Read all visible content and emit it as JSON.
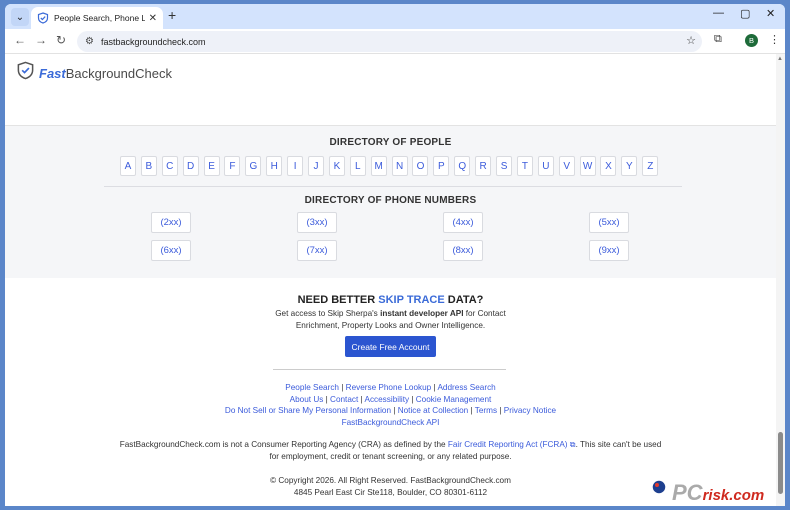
{
  "browser": {
    "tab_title": "People Search, Phone Lookup, A",
    "url": "fastbackgroundcheck.com",
    "profile_initial": "B"
  },
  "site": {
    "logo_fast": "Fast",
    "logo_rest": "BackgroundCheck"
  },
  "directory_people": {
    "title": "DIRECTORY OF PEOPLE",
    "letters": [
      "A",
      "B",
      "C",
      "D",
      "E",
      "F",
      "G",
      "H",
      "I",
      "J",
      "K",
      "L",
      "M",
      "N",
      "O",
      "P",
      "Q",
      "R",
      "S",
      "T",
      "U",
      "V",
      "W",
      "X",
      "Y",
      "Z"
    ]
  },
  "directory_phones": {
    "title": "DIRECTORY OF PHONE NUMBERS",
    "numbers": [
      "(2xx)",
      "(3xx)",
      "(4xx)",
      "(5xx)",
      "(6xx)",
      "(7xx)",
      "(8xx)",
      "(9xx)"
    ]
  },
  "cta": {
    "title_a": "NEED BETTER ",
    "title_b": "SKIP TRACE",
    "title_c": " DATA?",
    "desc_a": "Get access to Skip Sherpa's ",
    "desc_b": "instant developer API",
    "desc_c": " for Contact Enrichment, Property Looks and Owner Intelligence.",
    "button": "Create Free Account"
  },
  "footer_links": {
    "people_search": "People Search",
    "reverse_phone": "Reverse Phone Lookup",
    "address_search": "Address Search",
    "about_us": "About Us",
    "contact": "Contact",
    "accessibility": "Accessibility",
    "cookie_mgmt": "Cookie Management",
    "do_not_sell": "Do Not Sell or Share My Personal Information",
    "notice": "Notice at Collection",
    "terms": "Terms",
    "privacy": "Privacy Notice",
    "api": "FastBackgroundCheck API"
  },
  "disclaimer": {
    "part_a": "FastBackgroundCheck.com is not a Consumer Reporting Agency (CRA) as defined by the ",
    "fcra_link": "Fair Credit Reporting Act (FCRA)",
    "part_b": ". This site can't be used for employment, credit or tenant screening, or any related purpose."
  },
  "copyright": {
    "line1": "© Copyright 2026. All Right Reserved. FastBackgroundCheck.com",
    "line2": "4845 Pearl East Cir Ste118, Boulder, CO 80301-6112"
  },
  "watermark": {
    "pc": "PC",
    "risk": "risk.com"
  },
  "colors": {
    "accent": "#3b6bd8",
    "button": "#2b55d0",
    "link": "#3b5bdb"
  }
}
